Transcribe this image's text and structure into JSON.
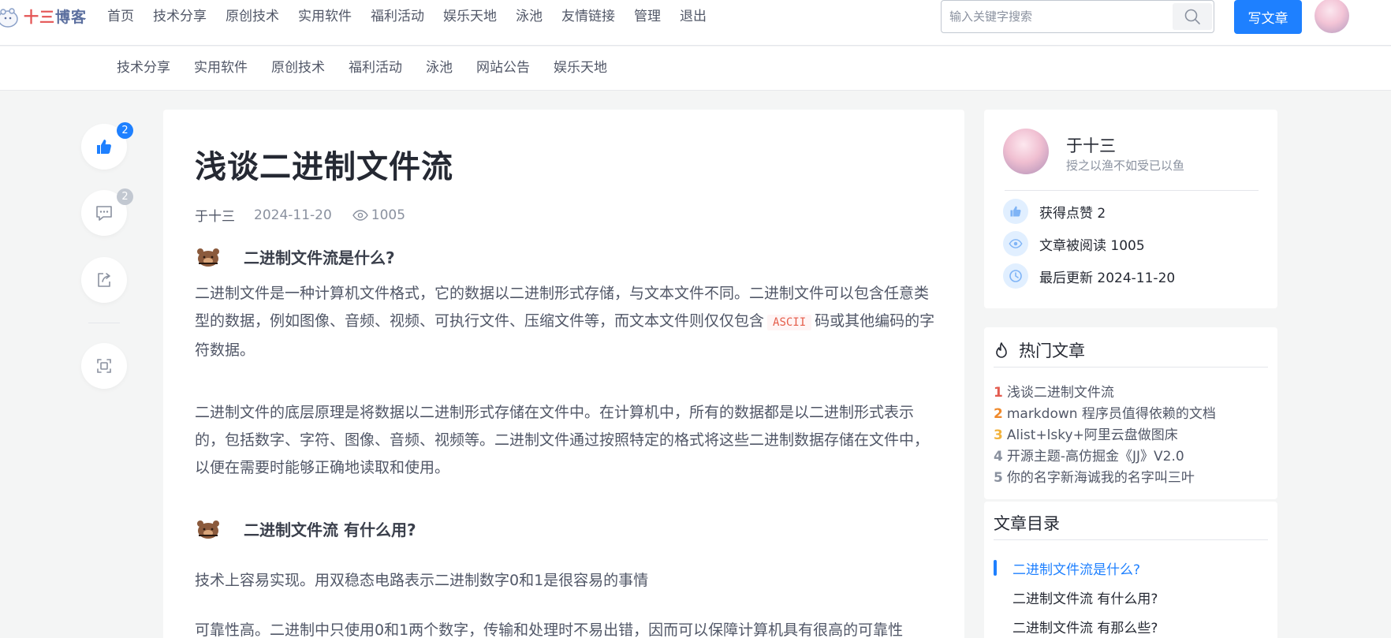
{
  "header": {
    "logo": {
      "prefix": "十三",
      "suffix": "博客"
    },
    "nav": [
      {
        "label": "首页"
      },
      {
        "label": "技术分享"
      },
      {
        "label": "原创技术"
      },
      {
        "label": "实用软件"
      },
      {
        "label": "福利活动"
      },
      {
        "label": "娱乐天地"
      },
      {
        "label": "泳池"
      },
      {
        "label": "友情链接"
      },
      {
        "label": "管理"
      },
      {
        "label": "退出"
      }
    ],
    "search": {
      "placeholder": "输入关键字搜索"
    },
    "write_label": "写文章"
  },
  "subnav": [
    {
      "label": "技术分享"
    },
    {
      "label": "实用软件"
    },
    {
      "label": "原创技术"
    },
    {
      "label": "福利活动"
    },
    {
      "label": "泳池"
    },
    {
      "label": "网站公告"
    },
    {
      "label": "娱乐天地"
    }
  ],
  "actions": {
    "like_count": "2",
    "comment_count": "2"
  },
  "article": {
    "title": "浅谈二进制文件流",
    "author": "于十三",
    "date": "2024-11-20",
    "views": "1005",
    "h1": "二进制文件流是什么?",
    "p1a": "二进制文件是一种计算机文件格式，它的数据以二进制形式存储，与文本文件不同。二进制文件可以包含任意类型的数据，例如图像、音频、视频、可执行文件、压缩文件等，而文本文件则仅仅包含",
    "p1code": "ASCII",
    "p1b": "码或其他编码的字符数据。",
    "p2": "二进制文件的底层原理是将数据以二进制形式存储在文件中。在计算机中，所有的数据都是以二进制形式表示的，包括数字、字符、图像、音频、视频等。二进制文件通过按照特定的格式将这些二进制数据存储在文件中，以便在需要时能够正确地读取和使用。",
    "h2": "二进制文件流 有什么用?",
    "p3": "技术上容易实现。用双稳态电路表示二进制数字0和1是很容易的事情",
    "p4": "可靠性高。二进制中只使用0和1两个数字，传输和处理时不易出错，因而可以保障计算机具有很高的可靠性"
  },
  "author_card": {
    "name": "于十三",
    "motto": "授之以渔不如受已以鱼",
    "likes_text": "获得点赞 2",
    "reads_text": "文章被阅读 1005",
    "updated_text": "最后更新 2024-11-20"
  },
  "hot": {
    "title": "热门文章",
    "items": [
      {
        "rank": "1",
        "title": "浅谈二进制文件流",
        "color": "#e35b4f"
      },
      {
        "rank": "2",
        "title": "markdown 程序员值得依赖的文档",
        "color": "#f08a2c"
      },
      {
        "rank": "3",
        "title": "Alist+lsky+阿里云盘做图床",
        "color": "#f2b33d"
      },
      {
        "rank": "4",
        "title": "开源主题-高仿掘金《JJ》V2.0",
        "color": "#8a919f"
      },
      {
        "rank": "5",
        "title": "你的名字新海诚我的名字叫三叶",
        "color": "#8a919f"
      }
    ]
  },
  "toc": {
    "title": "文章目录",
    "items": [
      {
        "label": "二进制文件流是什么?"
      },
      {
        "label": "二进制文件流 有什么用?"
      },
      {
        "label": "二进制文件流 有那么些?"
      }
    ]
  },
  "colors": {
    "accent": "#1e80ff",
    "background": "#f4f5f5"
  }
}
